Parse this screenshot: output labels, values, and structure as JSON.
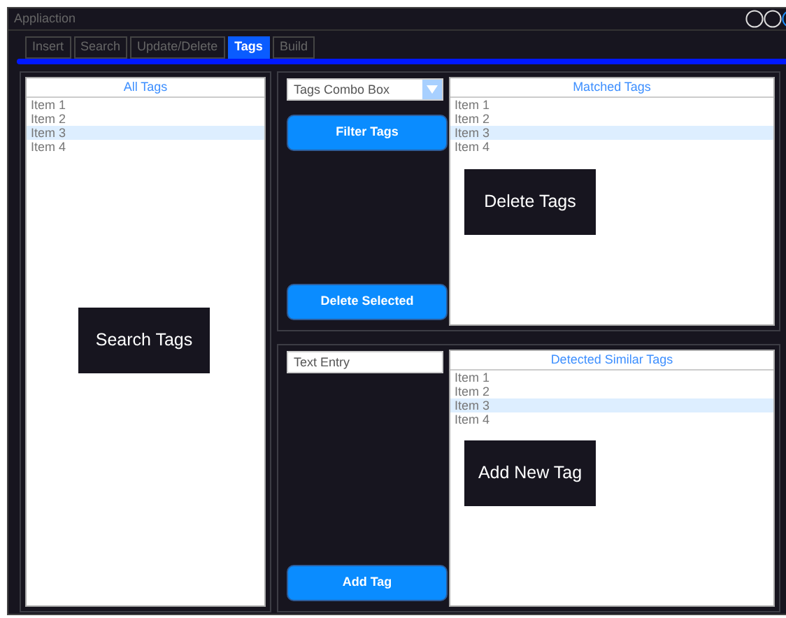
{
  "window": {
    "title": "Appliaction"
  },
  "tabs": [
    {
      "label": "Insert",
      "selected": false
    },
    {
      "label": "Search",
      "selected": false
    },
    {
      "label": "Update/Delete",
      "selected": false
    },
    {
      "label": "Tags",
      "selected": true
    },
    {
      "label": "Build",
      "selected": false
    }
  ],
  "all_tags": {
    "title": "All Tags",
    "items": [
      {
        "label": "Item 1",
        "selected": false
      },
      {
        "label": "Item 2",
        "selected": false
      },
      {
        "label": "Item 3",
        "selected": true
      },
      {
        "label": "Item 4",
        "selected": false
      }
    ],
    "overlay_label": "Search Tags"
  },
  "filter_panel": {
    "combo": {
      "value": "Tags Combo Box"
    },
    "buttons": [
      {
        "label": "Filter Tags",
        "kind": "top"
      },
      {
        "label": "Delete Selected",
        "kind": "bottom"
      }
    ],
    "matched_tags": {
      "title": "Matched Tags",
      "items": [
        {
          "label": "Item 1",
          "selected": false
        },
        {
          "label": "Item 2",
          "selected": false
        },
        {
          "label": "Item 3",
          "selected": true
        },
        {
          "label": "Item 4",
          "selected": false
        }
      ],
      "overlay_label": "Delete Tags"
    }
  },
  "add_panel": {
    "text_entry": {
      "value": "Text Entry"
    },
    "buttons": [
      {
        "label": "Add Tag",
        "kind": "bottom"
      }
    ],
    "similar_tags": {
      "title": "Detected Similar Tags",
      "items": [
        {
          "label": "Item 1",
          "selected": false
        },
        {
          "label": "Item 2",
          "selected": false
        },
        {
          "label": "Item 3",
          "selected": true
        },
        {
          "label": "Item 4",
          "selected": false
        }
      ],
      "overlay_label": "Add New Tag"
    }
  }
}
